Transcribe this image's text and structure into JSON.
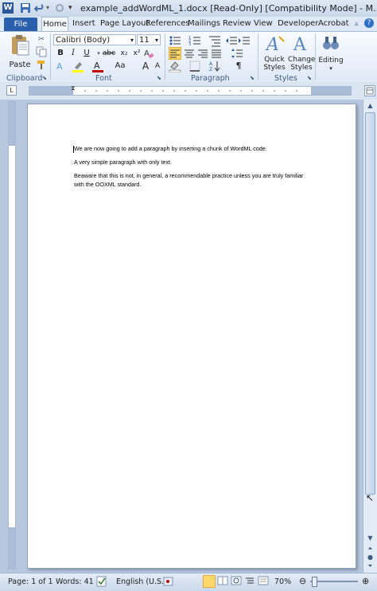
{
  "window": {
    "title": "example_addWordML_1.docx [Read-Only] [Compatibility Mode] - M..."
  },
  "tabs": {
    "file": "File",
    "items": [
      {
        "label": "Home",
        "active": true
      },
      {
        "label": "Insert"
      },
      {
        "label": "Page Layout"
      },
      {
        "label": "References"
      },
      {
        "label": "Mailings"
      },
      {
        "label": "Review"
      },
      {
        "label": "View"
      },
      {
        "label": "Developer"
      },
      {
        "label": "Acrobat"
      }
    ]
  },
  "ribbon": {
    "clipboard": {
      "paste_label": "Paste",
      "group_label": "Clipboard"
    },
    "font": {
      "font_name": "Calibri (Body)",
      "font_size": "11",
      "group_label": "Font",
      "bold": "B",
      "italic": "I",
      "underline": "U",
      "strike": "abc",
      "subscript": "x₂",
      "superscript": "x²",
      "grow": "A",
      "shrink": "A",
      "case": "Aa",
      "clear": "A"
    },
    "paragraph": {
      "group_label": "Paragraph",
      "pilcrow": "¶"
    },
    "styles": {
      "quick_label": "Quick Styles",
      "change_label": "Change Styles",
      "group_label": "Styles"
    },
    "editing": {
      "label": "Editing"
    }
  },
  "document": {
    "paragraphs": [
      "We are now going to add a paragraph by inserting a chunk of WordML code.",
      "A very simple paragraph with only text.",
      "Beaware that this is not, in general, a recommendable practice unless you are truly familiar",
      "with the OOXML standard."
    ]
  },
  "status": {
    "page": "Page: 1 of 1",
    "words": "Words: 41",
    "language": "English (U.S.)",
    "zoom": "70%"
  },
  "colors": {
    "file_tab": "#2a5fae",
    "ribbon_bg": "#dfe9f5",
    "workspace": "#b6c7de",
    "highlight_yellow": "#ffff00",
    "font_color_red": "#c00000"
  }
}
